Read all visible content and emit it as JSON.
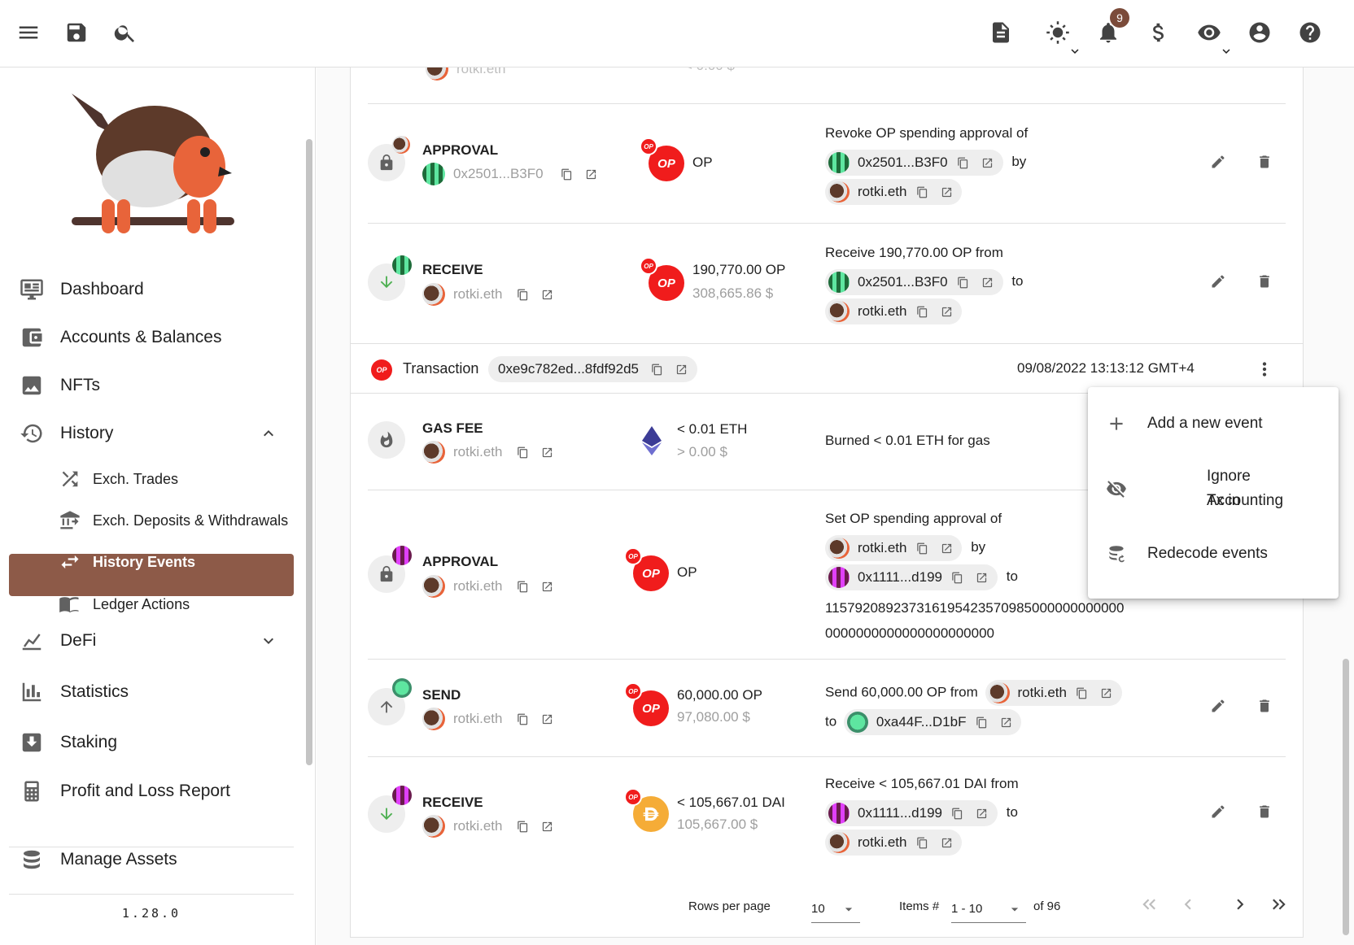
{
  "topbar": {
    "notification_count": "9"
  },
  "sidebar": {
    "version": "1.28.0",
    "nav": {
      "dashboard": "Dashboard",
      "accounts": "Accounts & Balances",
      "nfts": "NFTs",
      "history": "History",
      "exch_trades": "Exch. Trades",
      "exch_deposits": "Exch. Deposits & Withdrawals",
      "history_events": "History Events",
      "ledger_actions": "Ledger Actions",
      "defi": "DeFi",
      "statistics": "Statistics",
      "staking": "Staking",
      "pnl": "Profit and Loss Report",
      "manage_assets": "Manage Assets"
    }
  },
  "partial_top": {
    "addr": "rotki.eth",
    "value": "< 0.00 $"
  },
  "group1": [
    {
      "type": "APPROVAL",
      "address": "0x2501...B3F0",
      "asset_symbol": "OP",
      "amount": "",
      "value": "",
      "desc_prefix": "Revoke OP spending approval of",
      "chip1": "0x2501...B3F0",
      "connector": "by",
      "chip2": "rotki.eth"
    },
    {
      "type": "RECEIVE",
      "address": "rotki.eth",
      "asset_symbol": "OP",
      "amount": "190,770.00 OP",
      "value": "308,665.86 $",
      "desc_prefix": "Receive 190,770.00 OP from",
      "chip1": "0x2501...B3F0",
      "connector": "to",
      "chip2": "rotki.eth"
    }
  ],
  "transaction": {
    "label": "Transaction",
    "hash": "0xe9c782ed...8fdf92d5",
    "timestamp": "09/08/2022 13:13:12 GMT+4",
    "chain_badge": "OP"
  },
  "group2": [
    {
      "type": "GAS FEE",
      "address": "rotki.eth",
      "amount": "< 0.01 ETH",
      "value": "> 0.00 $",
      "desc": "Burned < 0.01 ETH for gas"
    },
    {
      "type": "APPROVAL",
      "address": "rotki.eth",
      "asset_symbol": "OP",
      "desc_prefix": "Set OP spending approval of",
      "chip1": "rotki.eth",
      "connector1": "by",
      "chip2": "0x1111...d199",
      "connector2": "to",
      "amount_line1": "115792089237316195423570985000000000000",
      "amount_line2": "0000000000000000000000"
    },
    {
      "type": "SEND",
      "address": "rotki.eth",
      "asset_symbol": "OP",
      "amount": "60,000.00 OP",
      "value": "97,080.00 $",
      "desc_prefix": "Send 60,000.00 OP from",
      "chip1": "rotki.eth",
      "connector": "to",
      "chip2": "0xa44F...D1bF"
    },
    {
      "type": "RECEIVE",
      "address": "rotki.eth",
      "amount": "< 105,667.01 DAI",
      "value": "105,667.00 $",
      "desc_prefix": "Receive < 105,667.01 DAI from",
      "chip1": "0x1111...d199",
      "connector": "to",
      "chip2": "rotki.eth"
    }
  ],
  "context_menu": {
    "add_event": "Add a new event",
    "ignore_line1": "Ignore Tx in",
    "ignore_line2": "Accounting",
    "redecode": "Redecode events"
  },
  "pager": {
    "rows_label": "Rows per page",
    "rows_value": "10",
    "items_label": "Items #",
    "items_value": "1 - 10",
    "of_total": "of 96"
  },
  "colors": {
    "accent": "#8d5a48",
    "op_red": "#f01c1c",
    "dai_gold": "#f5ac37"
  }
}
